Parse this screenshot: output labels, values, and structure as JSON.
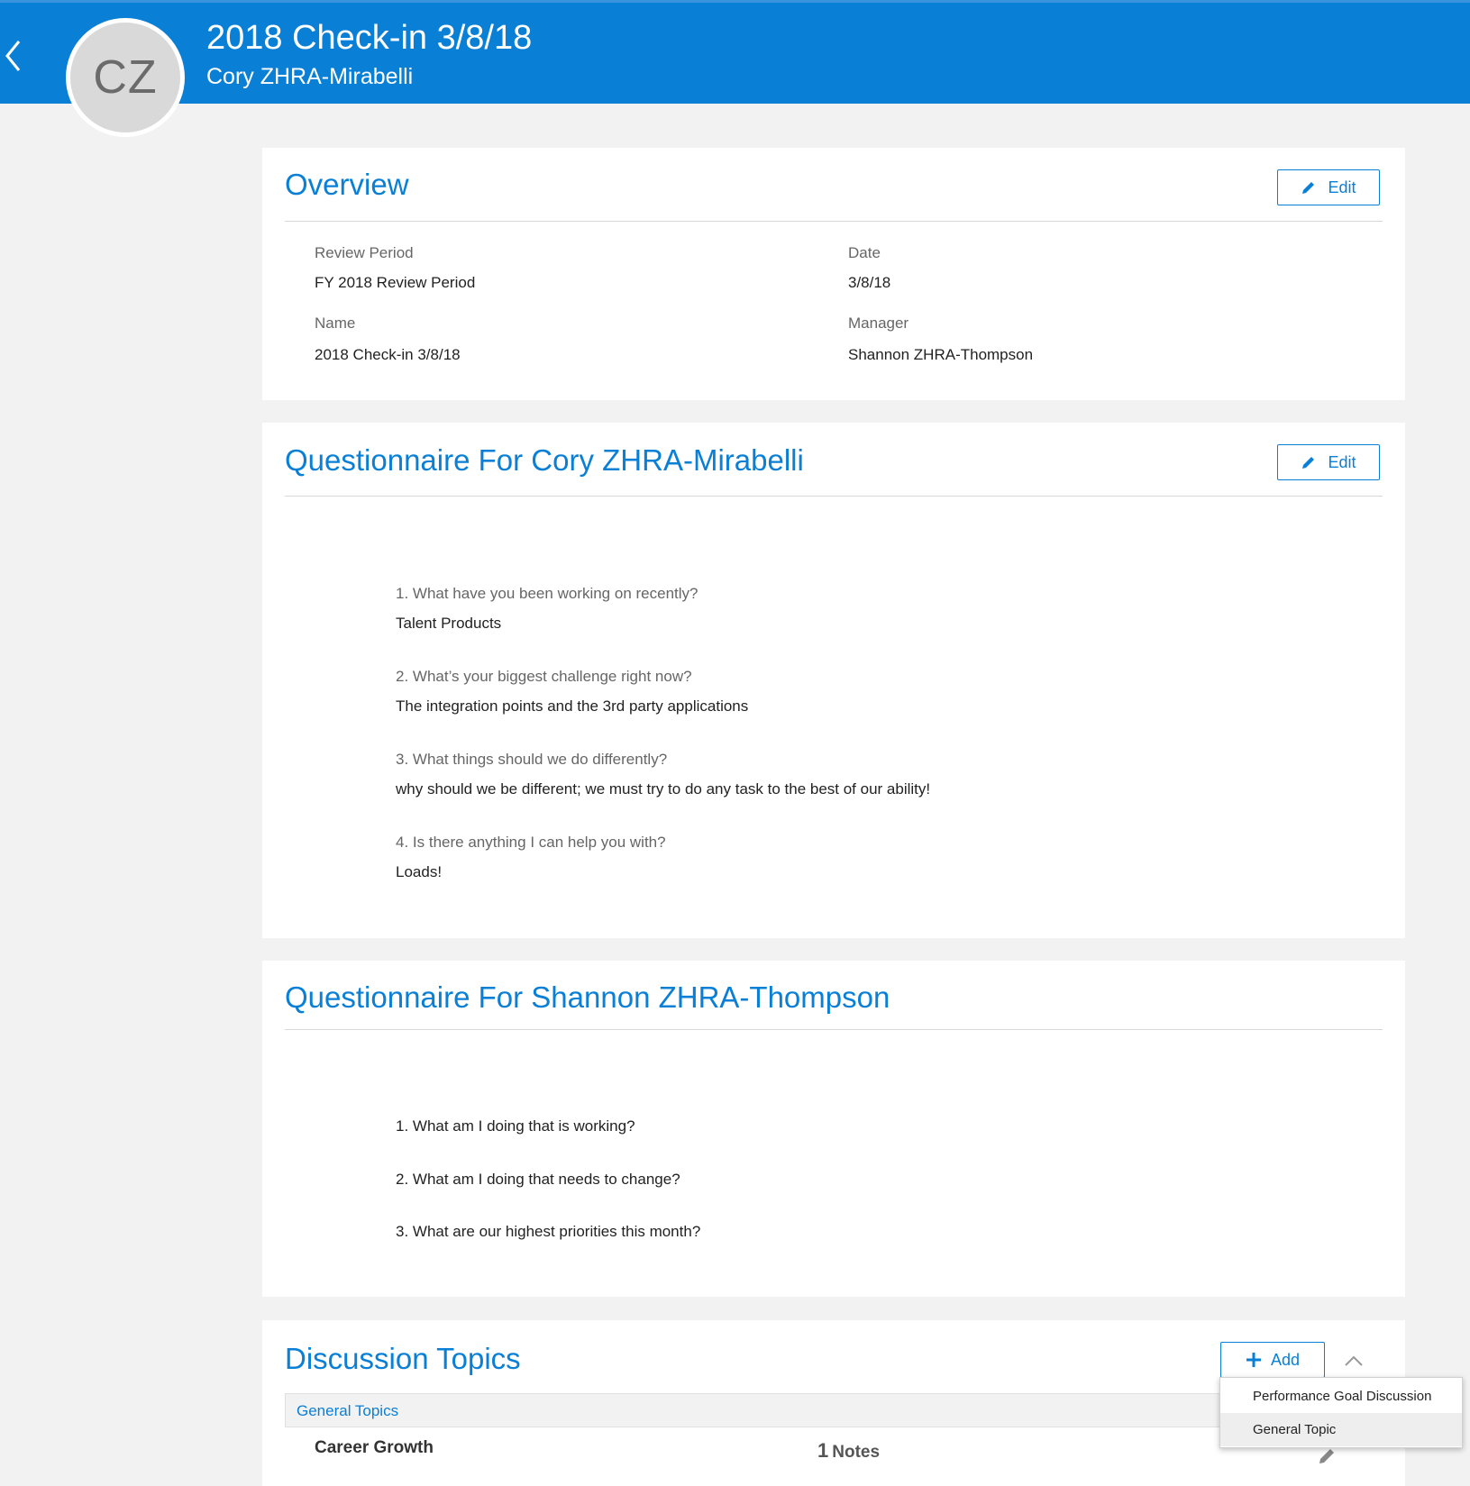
{
  "header": {
    "title": "2018 Check-in 3/8/18",
    "subtitle": "Cory ZHRA-Mirabelli",
    "avatar_initials": "CZ",
    "background_color": "#0a7fd6"
  },
  "overview": {
    "title": "Overview",
    "edit_label": "Edit",
    "fields": [
      {
        "label": "Review Period",
        "value": "FY 2018 Review Period"
      },
      {
        "label": "Date",
        "value": "3/8/18"
      },
      {
        "label": "Name",
        "value": "2018 Check-in 3/8/18"
      },
      {
        "label": "Manager",
        "value": "Shannon ZHRA-Thompson"
      }
    ]
  },
  "questionnaire_employee": {
    "title": "Questionnaire For Cory ZHRA-Mirabelli",
    "edit_label": "Edit",
    "questions": [
      {
        "question": "1. What have you been working on recently?",
        "answer": "Talent Products"
      },
      {
        "question": "2. What’s your biggest challenge right now?",
        "answer": "The integration points and the 3rd party applications"
      },
      {
        "question": "3. What things should we do differently?",
        "answer": "why should we be different; we must try to do any task to the best of our ability!"
      },
      {
        "question": "4. Is there anything I can help you with?",
        "answer": "Loads!"
      }
    ]
  },
  "questionnaire_manager": {
    "title": "Questionnaire For Shannon ZHRA-Thompson",
    "questions": [
      "1. What am I doing that is working?",
      "2. What am I doing that needs to change?",
      "3. What are our highest priorities this month?"
    ]
  },
  "discussion": {
    "title": "Discussion Topics",
    "add_label": "Add",
    "section_label": "General Topics",
    "topics": [
      {
        "name": "Career Growth",
        "notes_count": "1",
        "notes_label": "Notes"
      }
    ],
    "dropdown": [
      "Performance Goal Discussion",
      "General Topic"
    ]
  }
}
